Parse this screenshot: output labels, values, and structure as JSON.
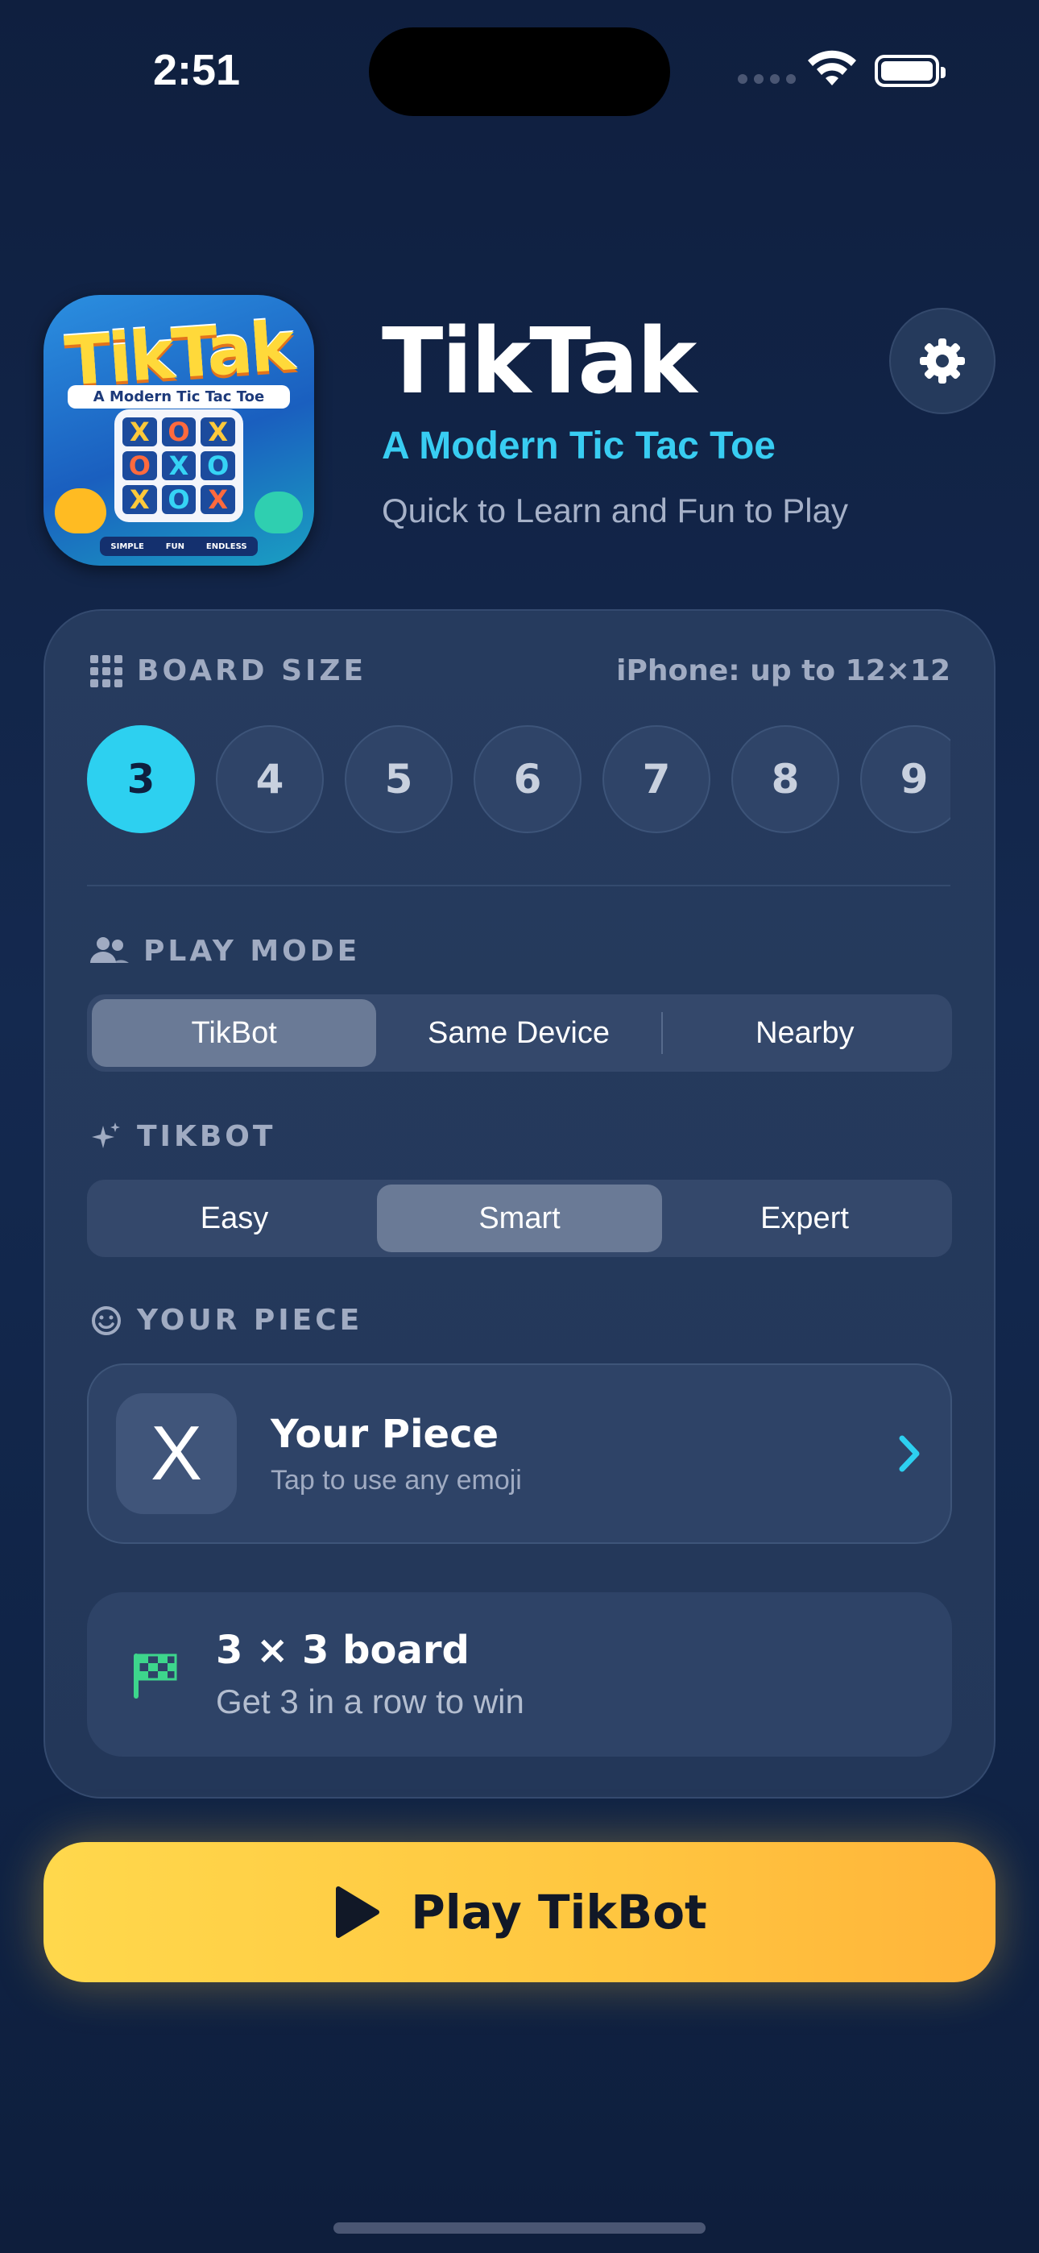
{
  "status_bar": {
    "time": "2:51"
  },
  "header": {
    "title": "TikTak",
    "subtitle": "A Modern Tic Tac Toe",
    "tagline": "Quick to Learn and Fun to Play",
    "app_icon": {
      "logo": "TikTak",
      "sub": "A Modern Tic Tac Toe",
      "board": [
        "X",
        "O",
        "X",
        "O",
        "X",
        "O",
        "X",
        "O",
        "X"
      ],
      "badges": [
        "SIMPLE",
        "FUN",
        "ENDLESS"
      ]
    }
  },
  "board_size": {
    "label": "BOARD SIZE",
    "limit": "iPhone: up to 12×12",
    "options": [
      "3",
      "4",
      "5",
      "6",
      "7",
      "8",
      "9"
    ],
    "selected": "3"
  },
  "play_mode": {
    "label": "PLAY MODE",
    "options": [
      "TikBot",
      "Same Device",
      "Nearby"
    ],
    "selected": "TikBot"
  },
  "tikbot": {
    "label": "TIKBOT",
    "options": [
      "Easy",
      "Smart",
      "Expert"
    ],
    "selected": "Smart"
  },
  "your_piece": {
    "label": "YOUR PIECE",
    "piece": "X",
    "title": "Your Piece",
    "subtitle": "Tap to use any emoji"
  },
  "info": {
    "title": "3 × 3 board",
    "subtitle": "Get 3 in a row to win"
  },
  "play_button": {
    "label": "Play TikBot"
  },
  "colors": {
    "accent": "#2dd0f0",
    "play": "#ffc640",
    "flag": "#3dd68c"
  }
}
